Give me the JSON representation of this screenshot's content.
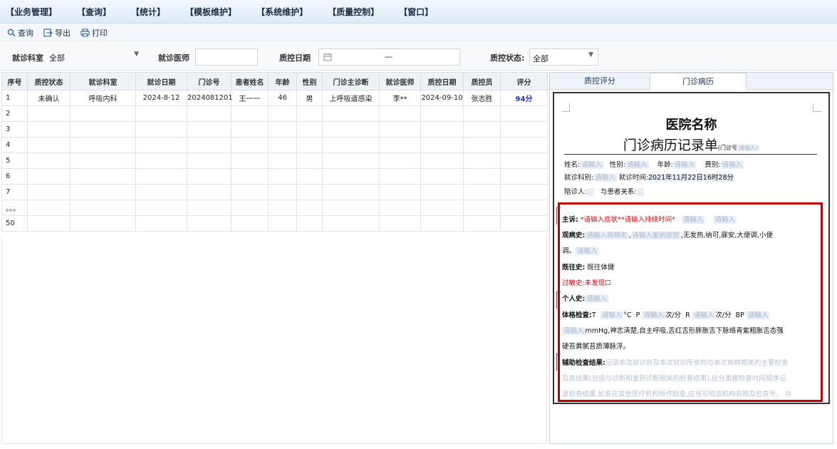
{
  "menu": [
    "【业务管理】",
    "【查询】",
    "【统计】",
    "【模板维护】",
    "【系统维护】",
    "【质量控制】",
    "【窗口】"
  ],
  "toolbar": {
    "query": "查询",
    "export": "导出",
    "print": "打印"
  },
  "filters": {
    "dept_label": "就诊科室",
    "dept_value": "全部",
    "doctor_label": "就诊医师",
    "date_label": "质控日期",
    "date_sep": "—",
    "status_label": "质控状态:",
    "status_value": "全部"
  },
  "grid": {
    "columns": [
      "序号",
      "质控状态",
      "就诊科室",
      "就诊日期",
      "门诊号",
      "患者姓名",
      "年龄",
      "性别",
      "门诊主诊断",
      "就诊医师",
      "质控日期",
      "质控员",
      "评分"
    ],
    "rows": [
      [
        "1",
        "未确认",
        "呼吸内科",
        "2024-8-12",
        "2024081201",
        "王一一",
        "46",
        "男",
        "上呼吸道感染",
        "李**",
        "2024-09-10",
        "张志胜",
        "94分"
      ],
      [
        "2",
        "",
        "",
        "",
        "",
        "",
        "",
        "",
        "",
        "",
        "",
        "",
        ""
      ],
      [
        "3",
        "",
        "",
        "",
        "",
        "",
        "",
        "",
        "",
        "",
        "",
        "",
        ""
      ],
      [
        "4",
        "",
        "",
        "",
        "",
        "",
        "",
        "",
        "",
        "",
        "",
        "",
        ""
      ],
      [
        "5",
        "",
        "",
        "",
        "",
        "",
        "",
        "",
        "",
        "",
        "",
        "",
        ""
      ],
      [
        "6",
        "",
        "",
        "",
        "",
        "",
        "",
        "",
        "",
        "",
        "",
        "",
        ""
      ],
      [
        "7",
        "",
        "",
        "",
        "",
        "",
        "",
        "",
        "",
        "",
        "",
        "",
        ""
      ],
      [
        "。。。",
        "",
        "",
        "",
        "",
        "",
        "",
        "",
        "",
        "",
        "",
        "",
        ""
      ],
      [
        "50",
        "",
        "",
        "",
        "",
        "",
        "",
        "",
        "",
        "",
        "",
        "",
        ""
      ]
    ]
  },
  "tabs": [
    "质控评分",
    "门诊病历"
  ],
  "doc": {
    "hospital": "医院名称",
    "title": "门诊病历记录单",
    "title_note": "(门诊号",
    "ph": "请输入",
    "ph_close": "请输入)",
    "name": "姓名:",
    "gender": "性别:",
    "age": "年龄:",
    "fee": "费别:",
    "dept": "就诊科别:",
    "visit_time_label": "就诊时间:",
    "visit_time": "2021年11月22日16时28分",
    "companion": "陪诊人:",
    "relation": "与患者关系:",
    "cc_label": "主诉:",
    "cc_red": "*请输入症状**请输入持续时间*",
    "hpi_label": "观病史:",
    "hpi_ph1": "请输入现病史",
    "hpi_ph2": "请输入鉴别症状",
    "hpi_text": ",无发热,纳可,寐安,大便调,小便",
    "hpi_text2": "调。",
    "past_label": "既往史:",
    "past_text": "既往体健",
    "allergy_label": "过敏史:",
    "allergy_text": "未发现",
    "personal_label": "个人史:",
    "exam_label": "体格检查:",
    "exam_t": "T",
    "exam_c": "°C",
    "exam_p": "P",
    "exam_unit": "次/分",
    "exam_r": "R",
    "exam_bp": "BP",
    "exam_text": "mmHg,神志清楚,自主呼吸,舌红舌形胖胀舌下脉络青紫粗胀舌态强",
    "exam_text2": "硬苔黄腻苔质薄脉浮。",
    "aux_label": "辅助检查结果:",
    "aux_ph1": "记录本次就诊前及本次就诊所查的与本次疾病相关的主要检查",
    "aux_ph2": "及其结果(包括与诊断和鉴别诊断相关的检查结果),应分类按检查时间顺序记",
    "aux_ph3": "录检查结果,如系在其他医疗机构所作检查,应当写明该机构名称及检查号。  共"
  }
}
